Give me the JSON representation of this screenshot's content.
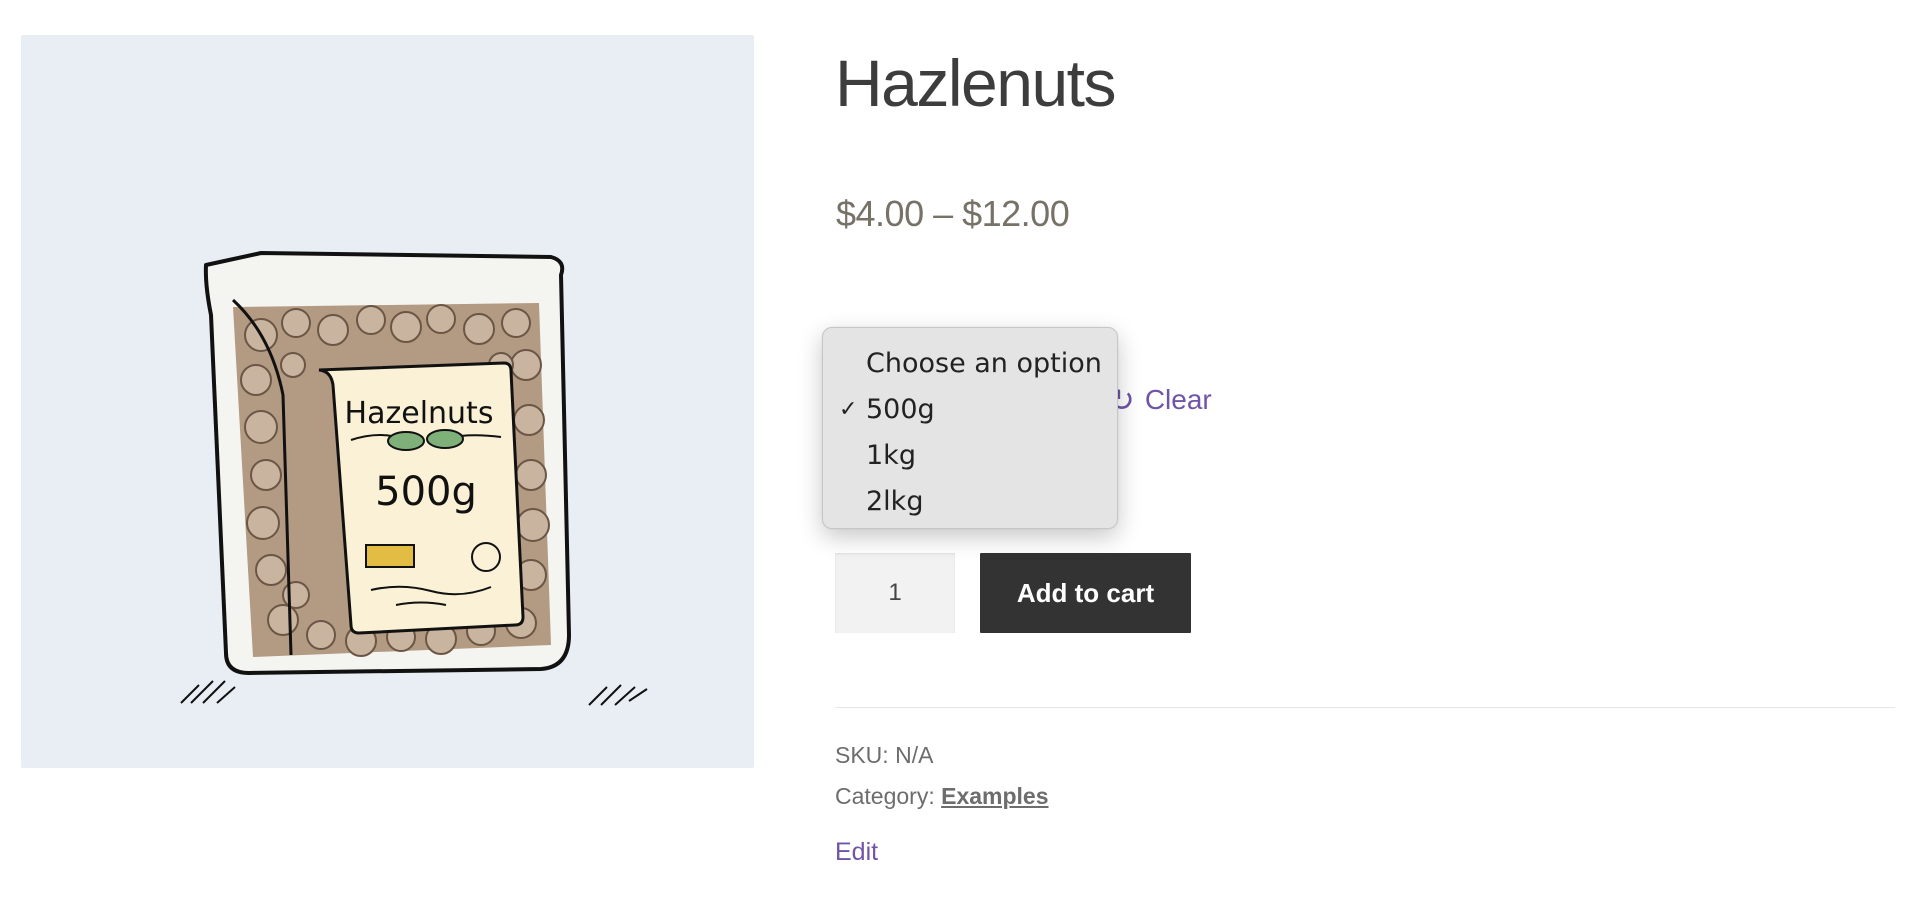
{
  "product": {
    "title": "Hazlenuts",
    "price": "$4.00 – $12.00",
    "image": {
      "label_title": "Hazelnuts",
      "label_weight": "500g",
      "colors": {
        "background": "#e8eef3",
        "nuts": "#b39a82",
        "label": "#faf1d6",
        "leaf": "#7fb07a",
        "tag": "#e3bd43"
      }
    }
  },
  "variation": {
    "options": [
      {
        "label": "Choose an option",
        "selected": false
      },
      {
        "label": "500g",
        "selected": true
      },
      {
        "label": "1kg",
        "selected": false
      },
      {
        "label": "2lkg",
        "selected": false
      }
    ],
    "checkmark": "✓",
    "clear_label": "Clear",
    "clear_icon": "refresh-icon"
  },
  "cart": {
    "quantity": "1",
    "add_to_cart_label": "Add to cart"
  },
  "meta": {
    "sku_label": "SKU:",
    "sku_value": "N/A",
    "category_label": "Category:",
    "category_value": "Examples"
  },
  "edit_label": "Edit",
  "colors": {
    "accent": "#7054a8",
    "button": "#333333",
    "price": "#777267"
  }
}
